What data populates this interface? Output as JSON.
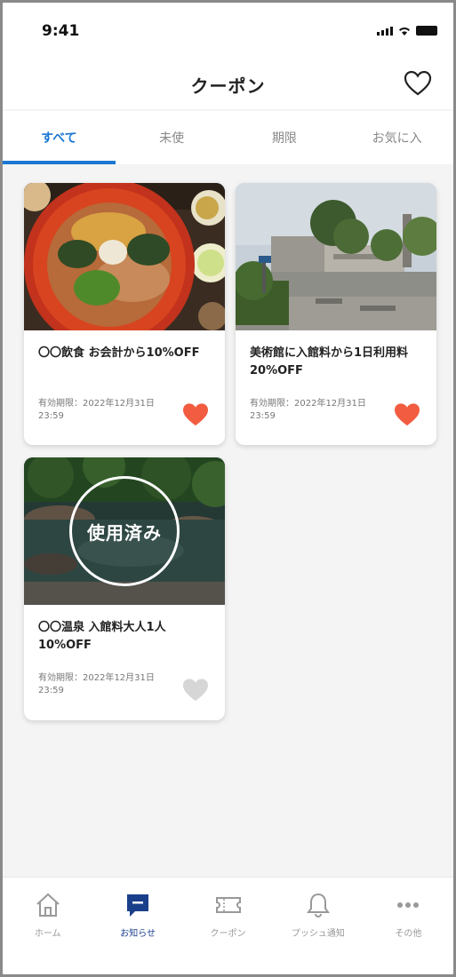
{
  "status_bar": {
    "time": "9:41"
  },
  "header": {
    "title": "クーポン"
  },
  "tabs": [
    {
      "label": "すべて",
      "active": true
    },
    {
      "label": "未使",
      "active": false
    },
    {
      "label": "期限",
      "active": false
    },
    {
      "label": "お気に入",
      "active": false
    }
  ],
  "coupons": [
    {
      "name": "〇〇飲食 お会計から10%OFF",
      "meta": "有効期限：2022年12月31日 23:59",
      "favorited": true,
      "used": false,
      "image": "food-bowl"
    },
    {
      "name": "美術館に入館料から1日利用料20%OFF",
      "meta": "有効期限：2022年12月31日 23:59",
      "favorited": true,
      "used": false,
      "image": "building"
    },
    {
      "name": "〇〇温泉 入館料大人1人10%OFF",
      "meta": "有効期限：2022年12月31日 23:59",
      "favorited": false,
      "used": true,
      "used_label": "使用済み",
      "image": "pond"
    }
  ],
  "bottom_nav": [
    {
      "label": "ホーム",
      "icon": "home-icon",
      "active": false
    },
    {
      "label": "お知らせ",
      "icon": "message-icon",
      "active": true
    },
    {
      "label": "クーポン",
      "icon": "ticket-icon",
      "active": false
    },
    {
      "label": "プッシュ通知",
      "icon": "bell-icon",
      "active": false
    },
    {
      "label": "その他",
      "icon": "more-icon",
      "active": false
    }
  ],
  "colors": {
    "accent": "#1a78d2",
    "heart_active": "#f25c40",
    "heart_inactive": "#d6d6d6",
    "nav_active": "#1a3f8a"
  }
}
